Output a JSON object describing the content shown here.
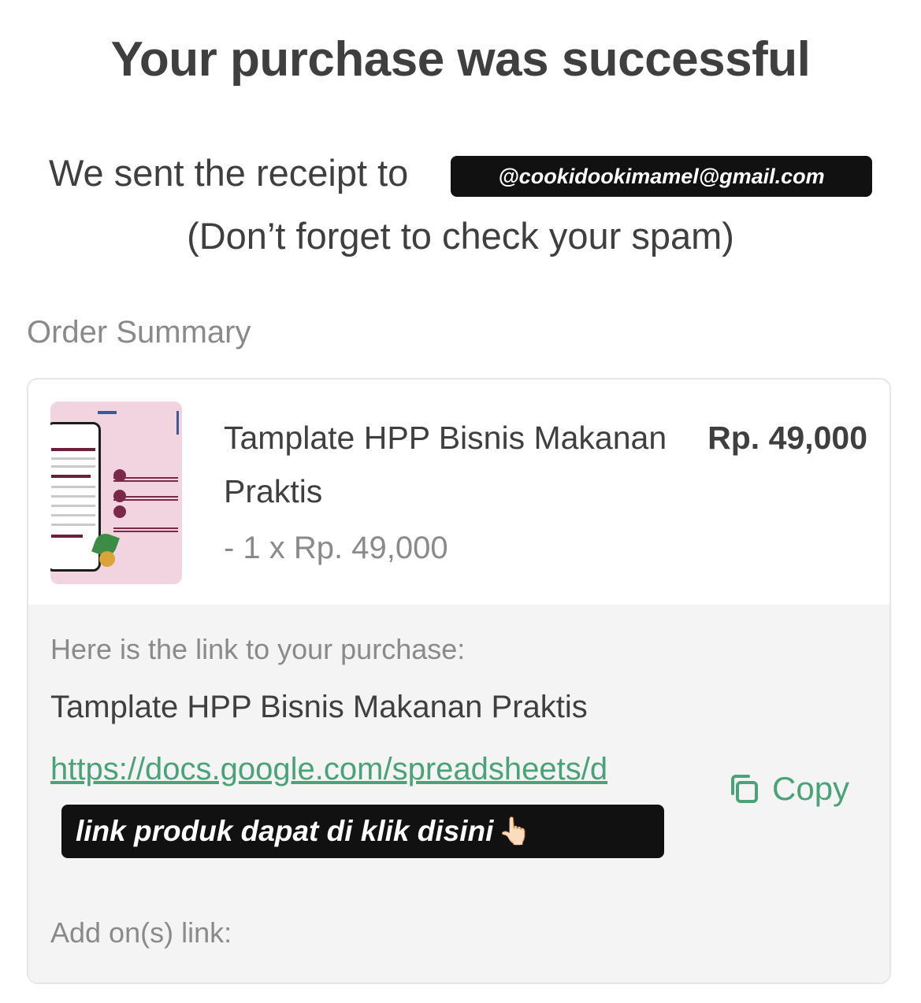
{
  "header": {
    "title": "Your purchase was successful",
    "receipt_prefix": "We sent the receipt to",
    "email": "@cookidookimamel@gmail.com",
    "spam_note": "(Don’t forget to check your spam)"
  },
  "order_summary": {
    "label": "Order Summary",
    "item": {
      "name": "Tamplate HPP Bisnis Makanan Praktis",
      "price": "Rp. 49,000",
      "quantity_line": "- 1 x Rp. 49,000",
      "thumbnail_icon": "product-thumbnail-image"
    }
  },
  "purchase_link": {
    "intro": "Here is the link to your purchase:",
    "product_name": "Tamplate HPP Bisnis Makanan Praktis",
    "url": "https://docs.google.com/spreadsheets/d",
    "copy_label": "Copy",
    "copy_icon": "copy-icon",
    "link_color": "#4aa378"
  },
  "overlay": {
    "sticker_text": "link produk dapat di klik disini",
    "sticker_emoji": "👆🏻"
  },
  "addons": {
    "label": "Add on(s) link:"
  }
}
